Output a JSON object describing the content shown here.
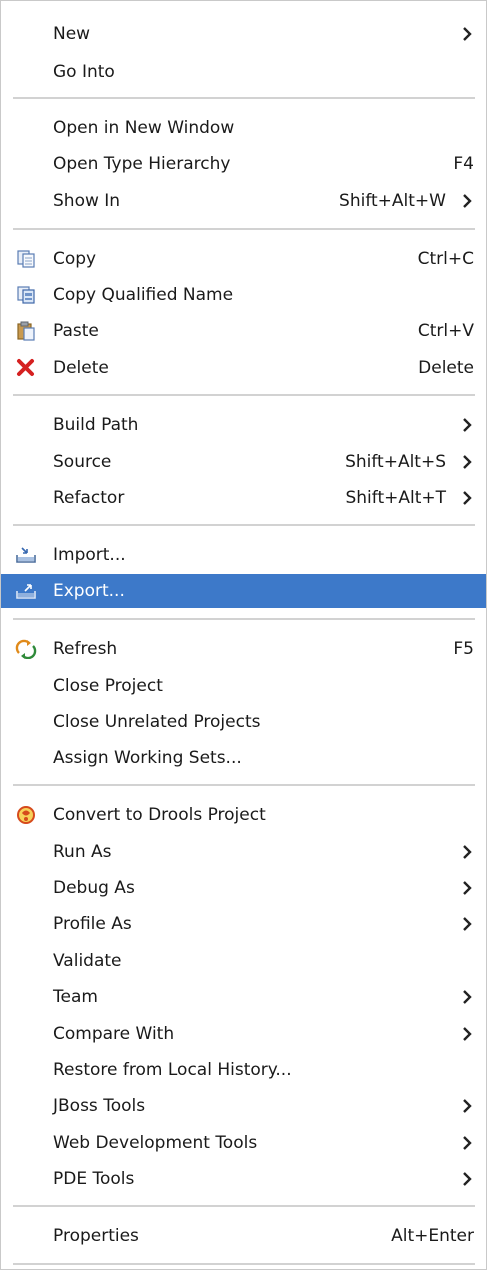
{
  "menu": {
    "items": [
      {
        "label": "New",
        "shortcut": "",
        "submenu": true
      },
      {
        "label": "Go Into",
        "shortcut": "",
        "submenu": false
      },
      {
        "label": "Open in New Window",
        "shortcut": "",
        "submenu": false
      },
      {
        "label": "Open Type Hierarchy",
        "shortcut": "F4",
        "submenu": false
      },
      {
        "label": "Show In",
        "shortcut": "Shift+Alt+W",
        "submenu": true
      },
      {
        "label": "Copy",
        "shortcut": "Ctrl+C",
        "submenu": false,
        "icon": "copy-icon"
      },
      {
        "label": "Copy Qualified Name",
        "shortcut": "",
        "submenu": false,
        "icon": "copy-qualified-name-icon"
      },
      {
        "label": "Paste",
        "shortcut": "Ctrl+V",
        "submenu": false,
        "icon": "paste-icon"
      },
      {
        "label": "Delete",
        "shortcut": "Delete",
        "submenu": false,
        "icon": "delete-icon"
      },
      {
        "label": "Build Path",
        "shortcut": "",
        "submenu": true
      },
      {
        "label": "Source",
        "shortcut": "Shift+Alt+S",
        "submenu": true
      },
      {
        "label": "Refactor",
        "shortcut": "Shift+Alt+T",
        "submenu": true
      },
      {
        "label": "Import...",
        "shortcut": "",
        "submenu": false,
        "icon": "import-icon"
      },
      {
        "label": "Export...",
        "shortcut": "",
        "submenu": false,
        "icon": "export-icon",
        "selected": true
      },
      {
        "label": "Refresh",
        "shortcut": "F5",
        "submenu": false,
        "icon": "refresh-icon"
      },
      {
        "label": "Close Project",
        "shortcut": "",
        "submenu": false
      },
      {
        "label": "Close Unrelated Projects",
        "shortcut": "",
        "submenu": false
      },
      {
        "label": "Assign Working Sets...",
        "shortcut": "",
        "submenu": false
      },
      {
        "label": "Convert to Drools Project",
        "shortcut": "",
        "submenu": false,
        "icon": "drools-icon"
      },
      {
        "label": "Run As",
        "shortcut": "",
        "submenu": true
      },
      {
        "label": "Debug As",
        "shortcut": "",
        "submenu": true
      },
      {
        "label": "Profile As",
        "shortcut": "",
        "submenu": true
      },
      {
        "label": "Validate",
        "shortcut": "",
        "submenu": false
      },
      {
        "label": "Team",
        "shortcut": "",
        "submenu": true
      },
      {
        "label": "Compare With",
        "shortcut": "",
        "submenu": true
      },
      {
        "label": "Restore from Local History...",
        "shortcut": "",
        "submenu": false
      },
      {
        "label": "JBoss Tools",
        "shortcut": "",
        "submenu": true
      },
      {
        "label": "Web Development Tools",
        "shortcut": "",
        "submenu": true
      },
      {
        "label": "PDE Tools",
        "shortcut": "",
        "submenu": true
      },
      {
        "label": "Properties",
        "shortcut": "Alt+Enter",
        "submenu": false
      }
    ],
    "colors": {
      "selection": "#3d79c9",
      "text": "#1a1a1a",
      "separator": "#d2d2d2",
      "arrow": "#222222"
    }
  }
}
